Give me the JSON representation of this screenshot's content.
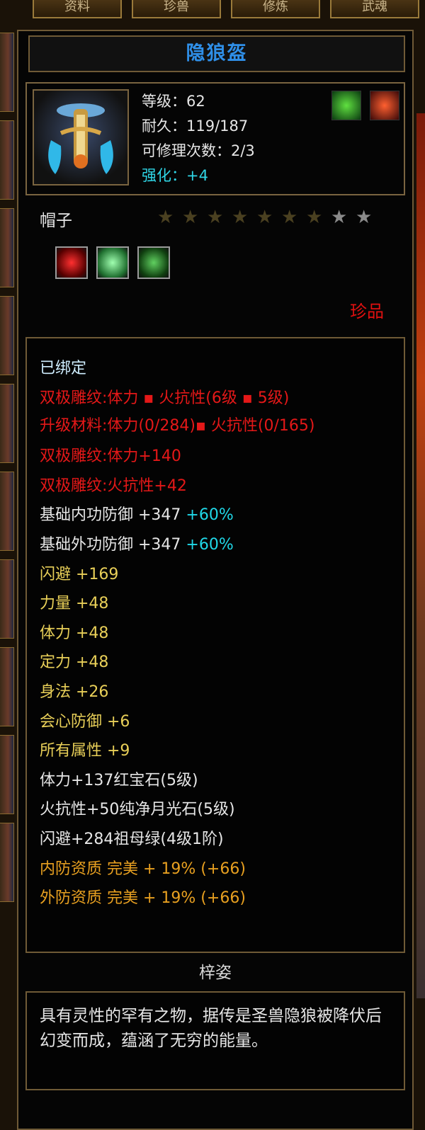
{
  "tabs": [
    "资料",
    "珍兽",
    "修炼",
    "武魂"
  ],
  "item": {
    "name": "隐狼盔",
    "level": "等级：62",
    "durability": "耐久：119/187",
    "repairs": "可修理次数：2/3",
    "enhance": "强化：+4",
    "category": "帽子",
    "stars_filled": 7,
    "stars_total": 9,
    "rarity": "珍品"
  },
  "attributes": {
    "bound": "已绑定",
    "carve_line": "双极雕纹:体力 ▪ 火抗性(6级 ▪ 5级)",
    "upgrade_line": "升级材料:体力(0/284)▪ 火抗性(0/165)",
    "carve_1": "双极雕纹:体力+140",
    "carve_2": "双极雕纹:火抗性+42",
    "inner_def": "基础内功防御  +347",
    "inner_def_pct": "+60%",
    "outer_def": "基础外功防御  +347",
    "outer_def_pct": "+60%",
    "dodge": "闪避  +169",
    "strength": "力量  +48",
    "stamina": "体力  +48",
    "focus": "定力  +48",
    "agility": "身法  +26",
    "crit_def": "会心防御  +6",
    "all_attr": "所有属性  +9",
    "gem_1": "体力+137红宝石(5级)",
    "gem_2": "火抗性+50纯净月光石(5级)",
    "gem_3": "闪避+284祖母绿(4级1阶)",
    "quality_inner": "内防资质  完美  +  19% (+66)",
    "quality_outer": "外防资质  完美  +  19% (+66)"
  },
  "set_name": "梓姿",
  "description": "具有灵性的罕有之物，据传是圣兽隐狼被降伏后幻变而成，蕴涵了无穷的能量。",
  "colors": {
    "title": "#2f8fe8",
    "red": "#e41818",
    "yellow": "#e8cf58",
    "orange": "#e8a020",
    "cyan": "#20d8e8"
  }
}
